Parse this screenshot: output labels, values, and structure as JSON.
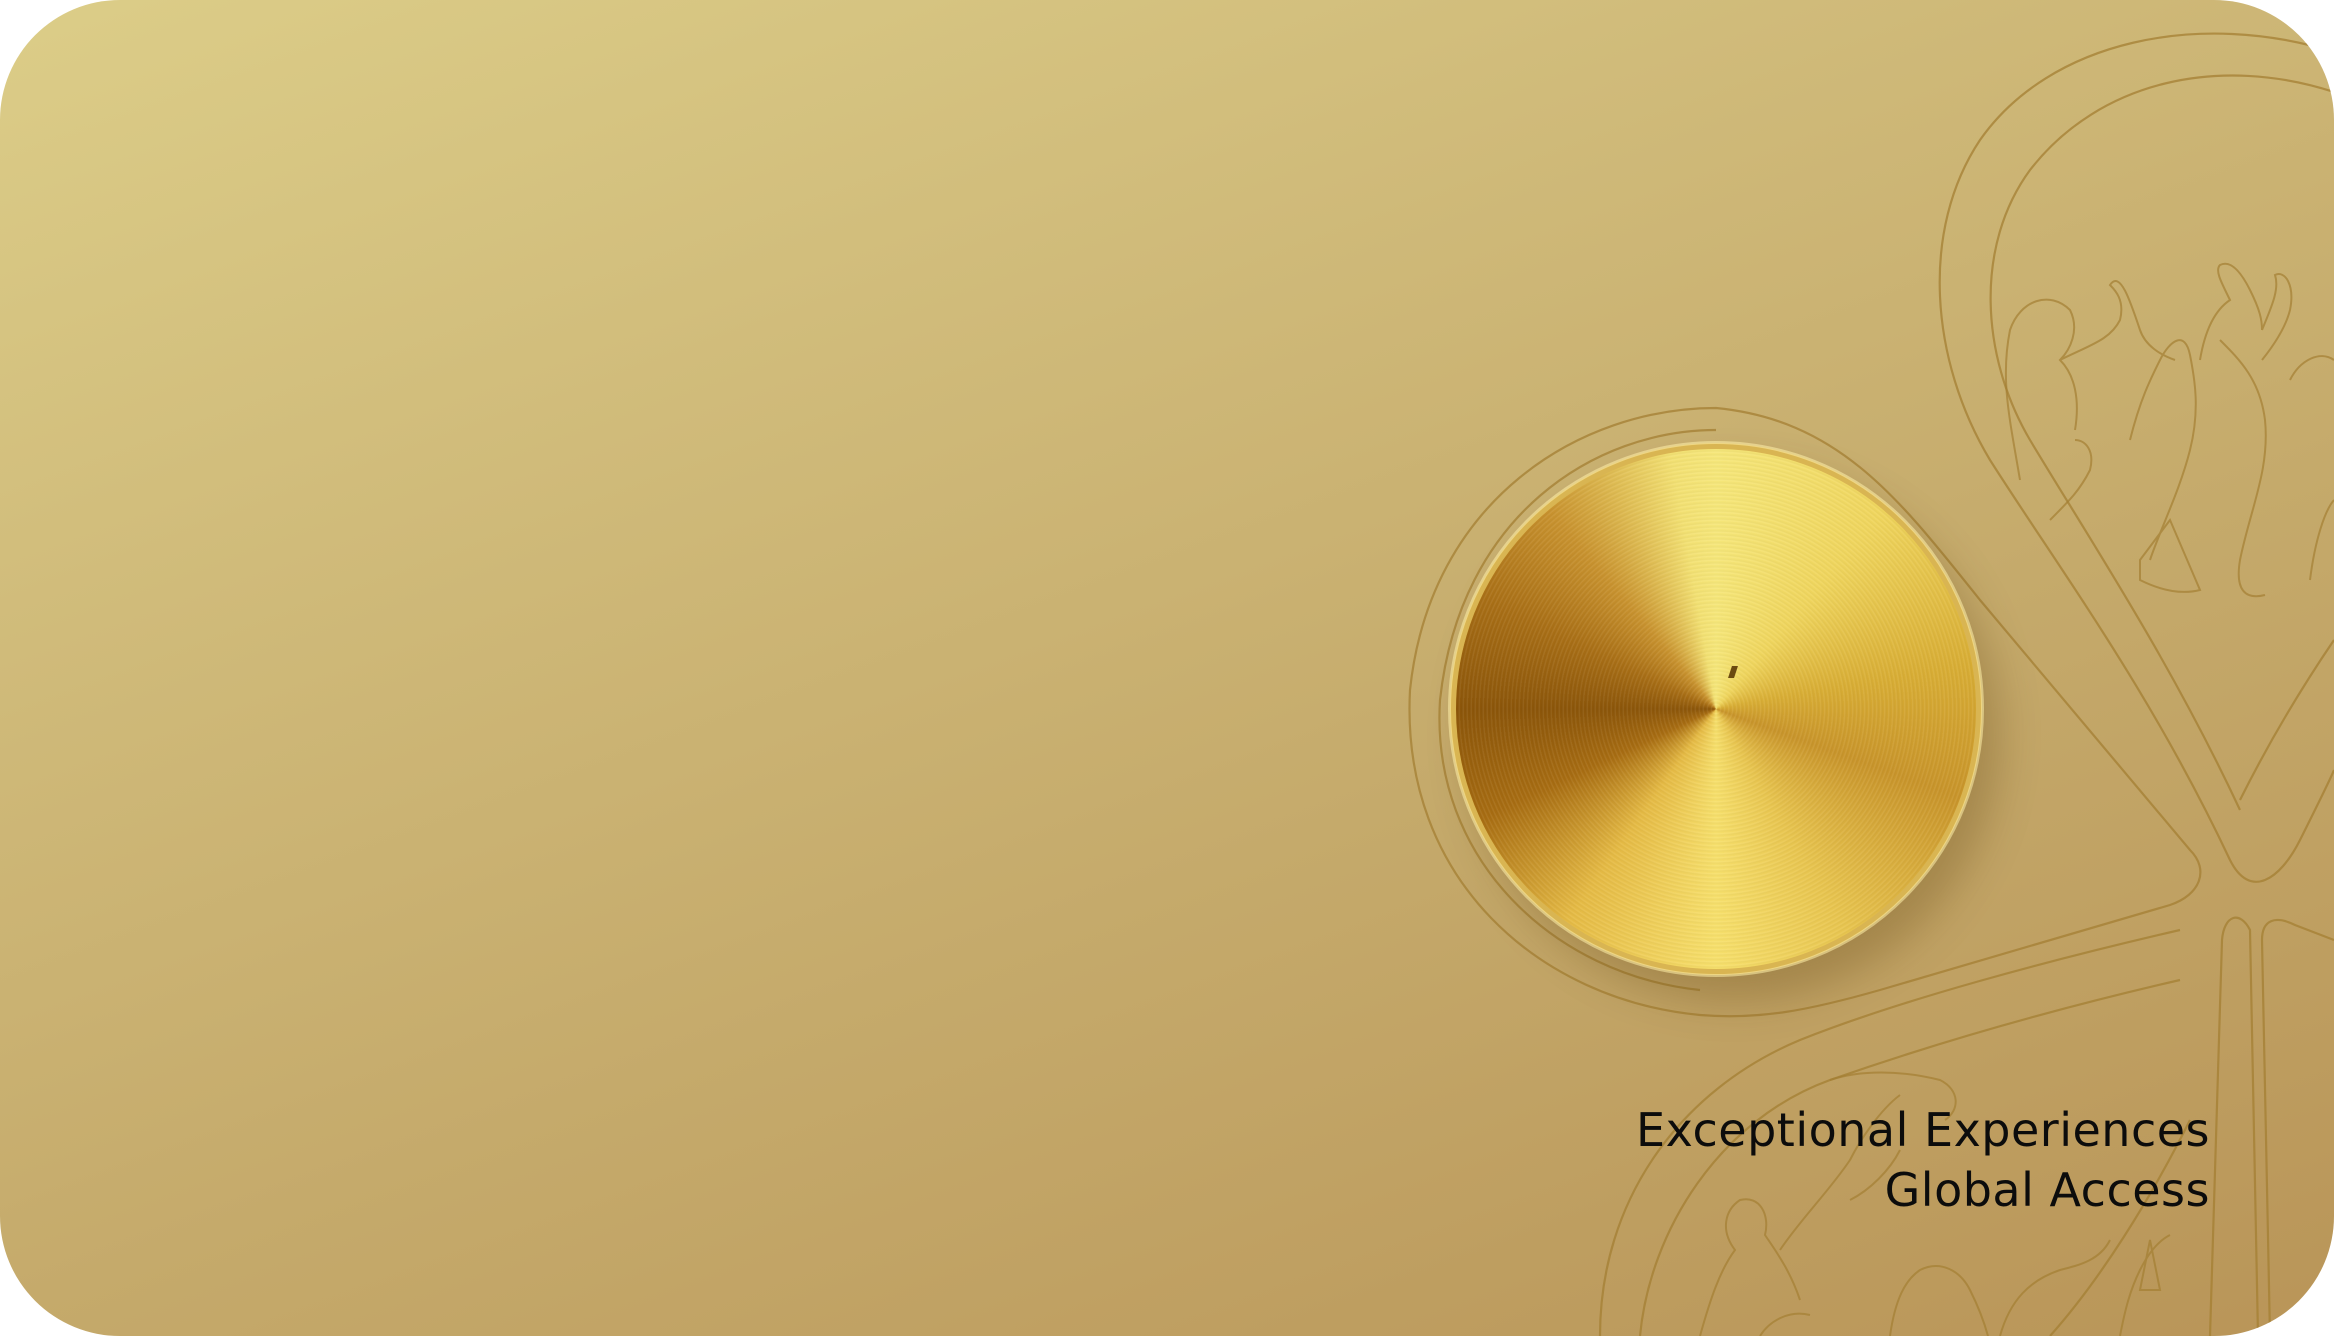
{
  "card": {
    "tagline_line1": "Exceptional Experiences",
    "tagline_line2": "Global Access"
  },
  "colors": {
    "card_gradient_start": "#dccd88",
    "card_gradient_end": "#b99558",
    "linework": "#a47f33",
    "medallion_highlight": "#f6e77a",
    "medallion_shadow": "#8c560a",
    "text": "#0c0c0c"
  },
  "icons": {
    "medallion": "brushed-gold-disc-icon",
    "decorative_pattern": "flower-petal-crowd-illustration"
  }
}
